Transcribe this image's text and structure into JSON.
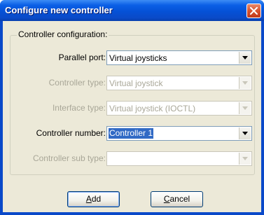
{
  "window": {
    "title": "Configure new controller",
    "close_icon": "close-icon"
  },
  "group": {
    "legend": "Controller configuration:"
  },
  "fields": [
    {
      "label": "Parallel port:",
      "value": "Virtual joysticks",
      "enabled": true
    },
    {
      "label": "Controller type:",
      "value": "Virtual joystick",
      "enabled": false
    },
    {
      "label": "Interface type:",
      "value": "Virtual joystick (IOCTL)",
      "enabled": false
    },
    {
      "label": "Controller number:",
      "value": "Controller 1",
      "enabled": true,
      "focused": true
    },
    {
      "label": "Controller sub type:",
      "value": "",
      "enabled": false
    }
  ],
  "buttons": {
    "add": {
      "mnemonic": "A",
      "rest": "dd"
    },
    "cancel": {
      "mnemonic": "C",
      "rest": "ancel"
    }
  },
  "colors": {
    "title_bar": "#0a5fe6",
    "dialog_face": "#ece9d8",
    "selection": "#316ac5",
    "close_button": "#d9532e"
  }
}
